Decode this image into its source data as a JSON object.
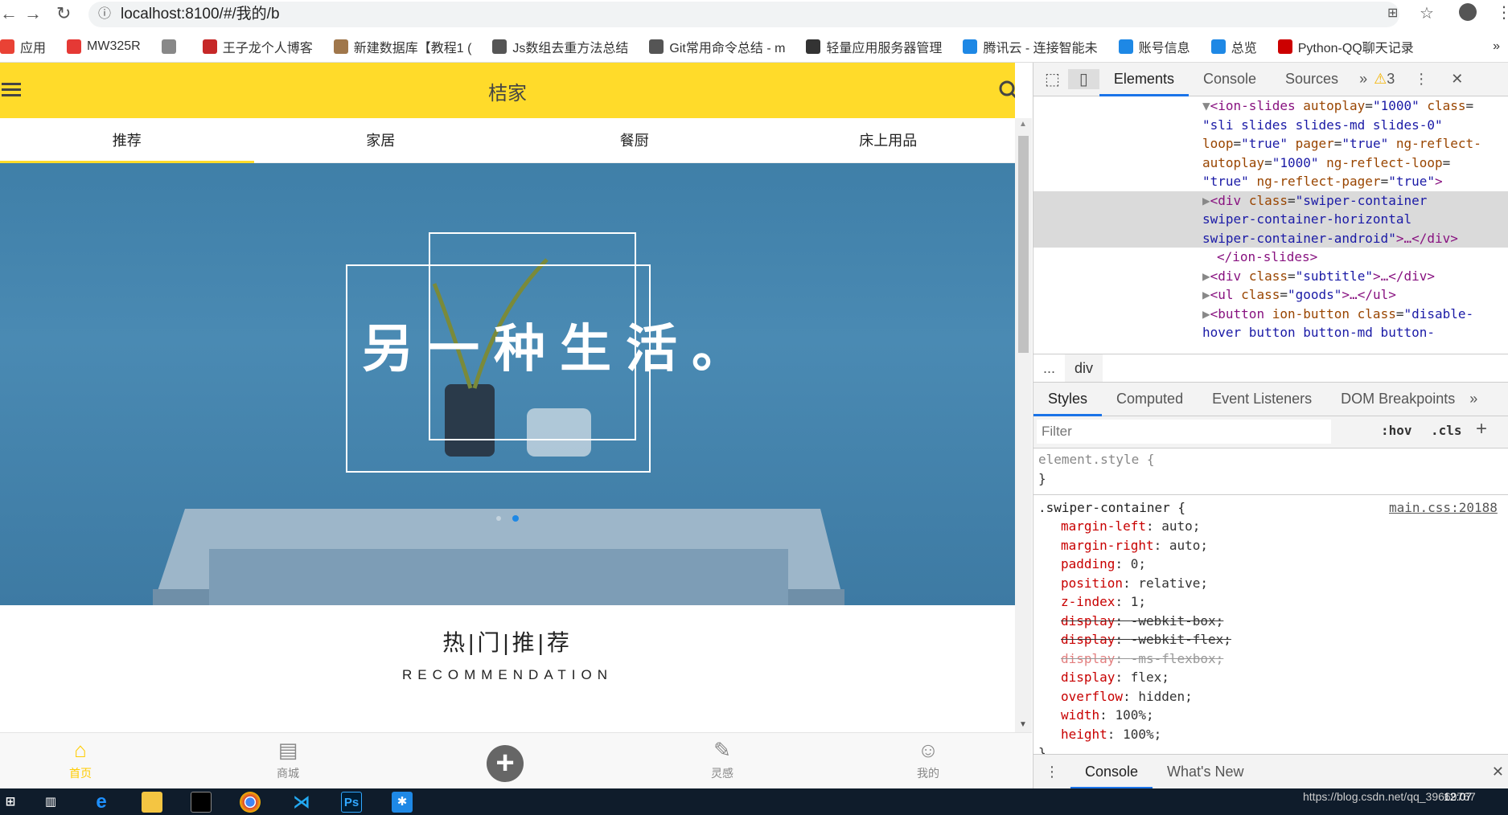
{
  "browser": {
    "url": "localhost:8100/#/我的/b",
    "bookmarks": [
      {
        "label": "应用",
        "color": "#e94235"
      },
      {
        "label": "MW325R",
        "color": "#e53935"
      },
      {
        "label": "",
        "color": "#888"
      },
      {
        "label": "王子龙个人博客",
        "color": "#c62828"
      },
      {
        "label": "新建数据库【教程1 (",
        "color": "#a0774b"
      },
      {
        "label": "Js数组去重方法总结",
        "color": "#555"
      },
      {
        "label": "Git常用命令总结 - m",
        "color": "#555"
      },
      {
        "label": "轻量应用服务器管理",
        "color": "#333"
      },
      {
        "label": "腾讯云 - 连接智能未",
        "color": "#1e88e5"
      },
      {
        "label": "账号信息",
        "color": "#1e88e5"
      },
      {
        "label": "总览",
        "color": "#1e88e5"
      },
      {
        "label": "Python-QQ聊天记录",
        "color": "#c00"
      }
    ],
    "more": "»"
  },
  "app": {
    "title": "桔家",
    "accent": "#ffdb2a",
    "tabs": [
      {
        "label": "推荐",
        "active": true
      },
      {
        "label": "家居"
      },
      {
        "label": "餐厨"
      },
      {
        "label": "床上用品"
      }
    ],
    "hero": {
      "caption": "另一种生活。",
      "pager_active": 1
    },
    "section_title": "热|门|推|荐",
    "section_subtitle": "RECOMMENDATION",
    "bottom_nav": [
      {
        "label": "首页",
        "icon": "home-icon",
        "active": true
      },
      {
        "label": "商城",
        "icon": "store-icon"
      },
      {
        "label": "",
        "icon": "plus-circle-icon"
      },
      {
        "label": "灵感",
        "icon": "inspiration-icon"
      },
      {
        "label": "我的",
        "icon": "user-icon"
      }
    ]
  },
  "devtools": {
    "tabs": [
      "Elements",
      "Console",
      "Sources"
    ],
    "warnings": "3",
    "breadcrumb": [
      "...",
      "div"
    ],
    "style_tabs": [
      "Styles",
      "Computed",
      "Event Listeners",
      "DOM Breakpoints"
    ],
    "filter_placeholder": "Filter",
    "hov": ":hov",
    "cls": ".cls",
    "element_style": "element.style {",
    "close_brace": "}",
    "selector": ".swiper-container {",
    "source": "main.css:20188",
    "props": [
      {
        "name": "margin-left",
        "value": "auto"
      },
      {
        "name": "margin-right",
        "value": "auto"
      },
      {
        "name": "padding",
        "value": "0"
      },
      {
        "name": "position",
        "value": "relative"
      },
      {
        "name": "z-index",
        "value": "1"
      },
      {
        "name": "display",
        "value": "-webkit-box",
        "struck": true
      },
      {
        "name": "display",
        "value": "-webkit-flex",
        "struck": true
      },
      {
        "name": "display",
        "value": "-ms-flexbox",
        "struck": true
      },
      {
        "name": "display",
        "value": "flex"
      },
      {
        "name": "overflow",
        "value": "hidden"
      },
      {
        "name": "width",
        "value": "100%"
      },
      {
        "name": "height",
        "value": "100%"
      }
    ],
    "drawer_tabs": [
      "Console",
      "What's New"
    ]
  },
  "taskbar": {
    "watermark": "https://blog.csdn.net/qq_39669767",
    "time": "12:07"
  }
}
